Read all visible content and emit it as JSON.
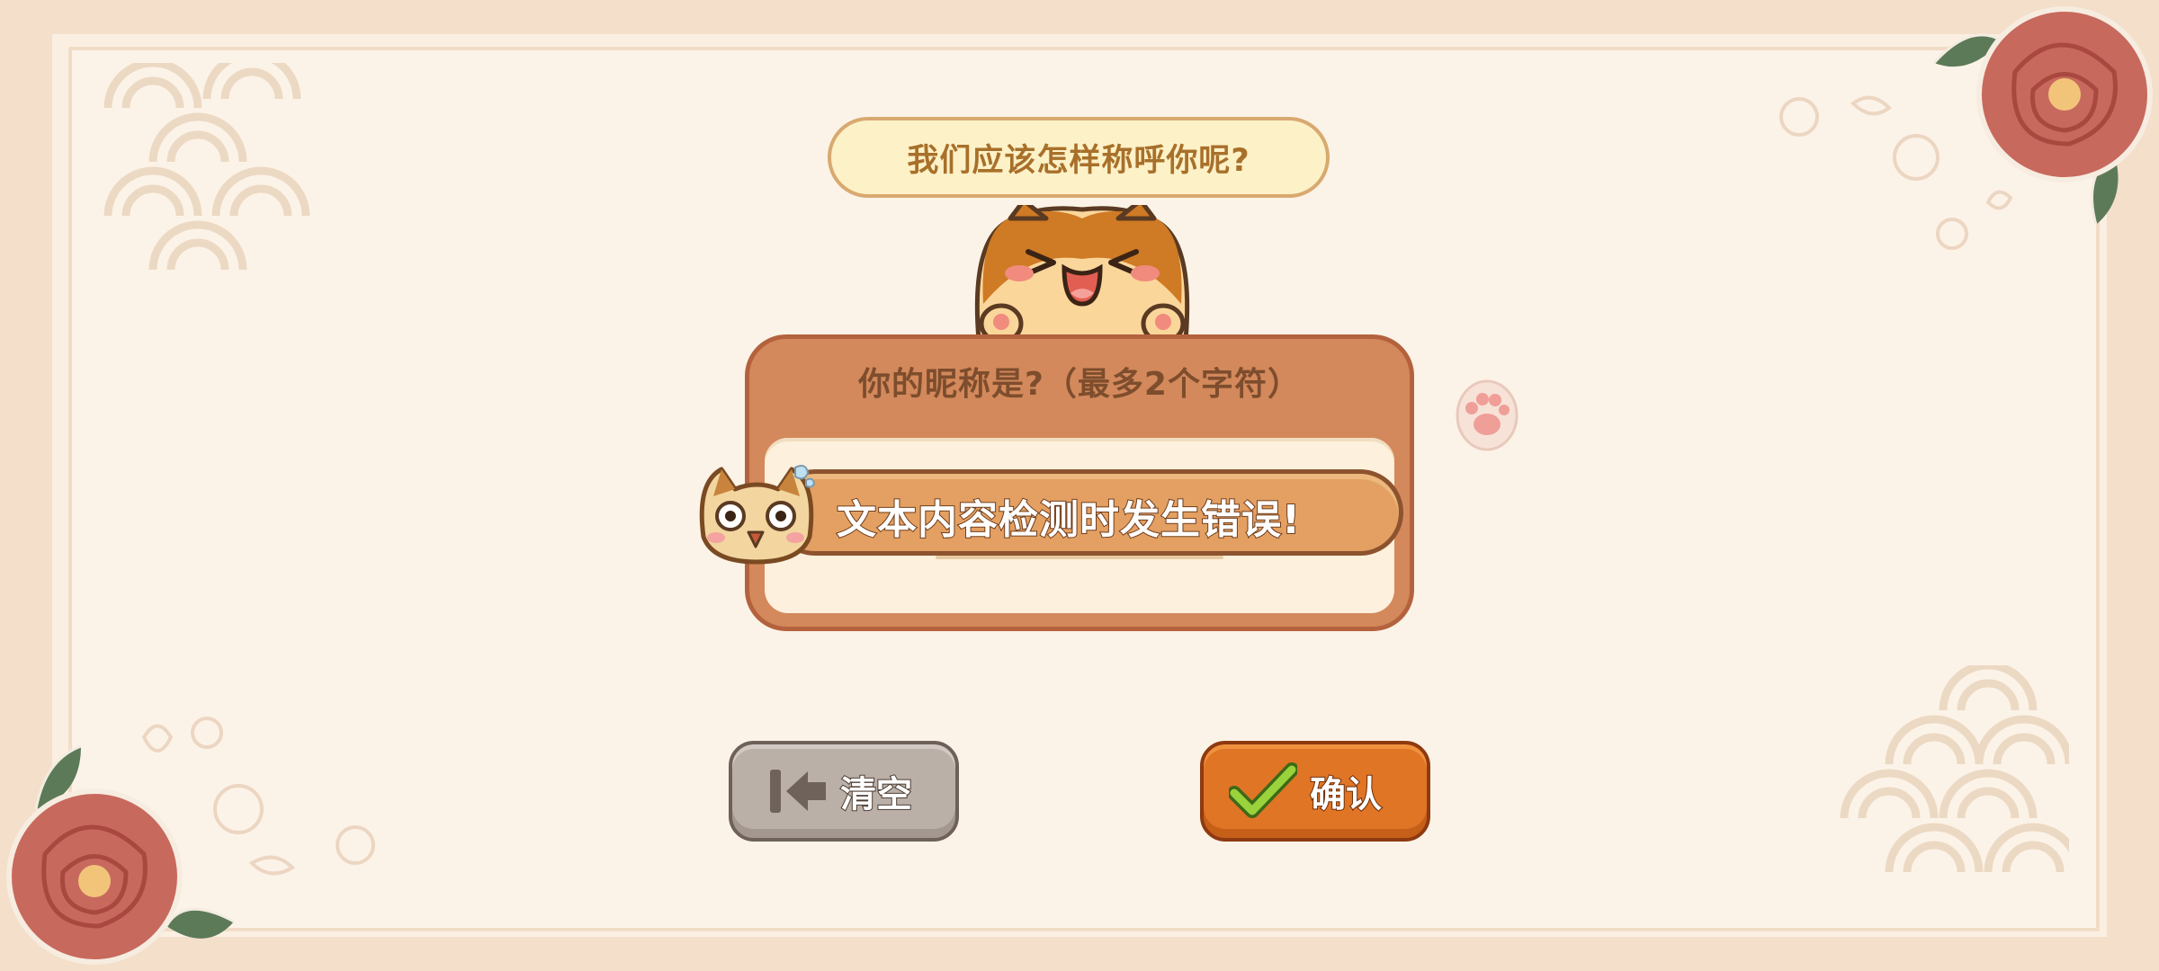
{
  "dialog": {
    "prompt": "我们应该怎样称呼你呢?",
    "card_title": "你的昵称是?（最多2个字符）",
    "input_value": "",
    "toast_message": "文本内容检测时发生错误!"
  },
  "buttons": {
    "clear_label": "清空",
    "confirm_label": "确认"
  },
  "colors": {
    "background": "#fbefe2",
    "card": "#d3895b",
    "toast": "#e3a062",
    "confirm_button": "#e07526",
    "clear_button": "#bbb0a8"
  },
  "icons": [
    "cat-mascot-icon",
    "cat-face-icon",
    "paw-icon",
    "flower-icon",
    "back-arrow-icon",
    "check-icon"
  ]
}
